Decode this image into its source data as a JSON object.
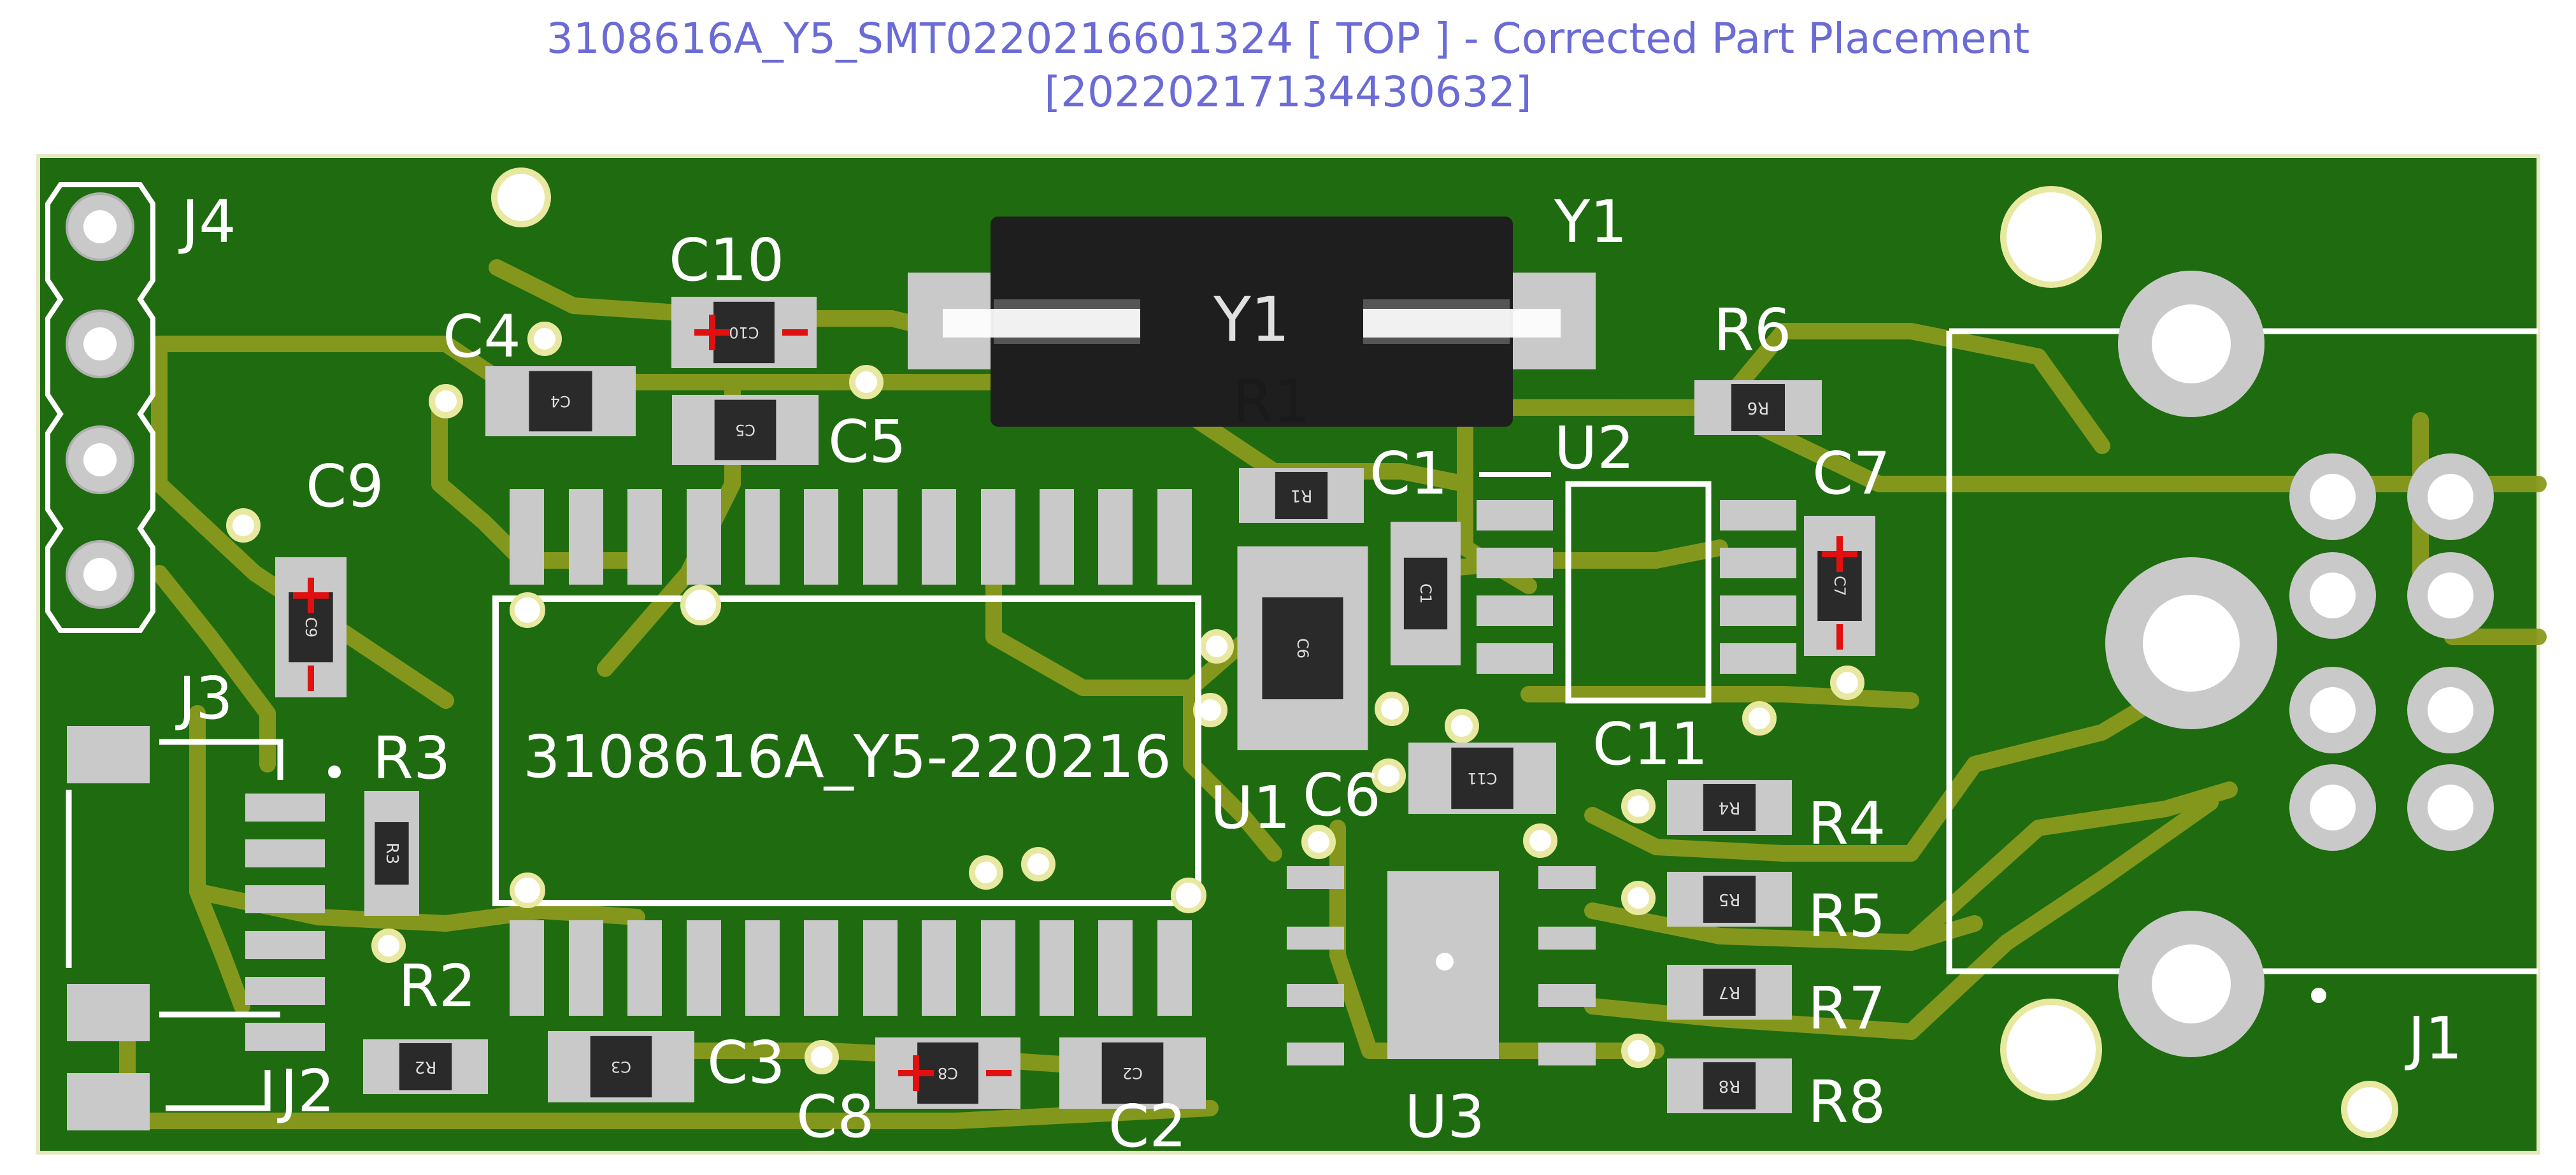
{
  "header": {
    "title": "3108616A_Y5_SMT0220216601324 [ TOP ] - Corrected Part Placement",
    "subtitle": "[20220217134430632]"
  },
  "colors": {
    "board": "#1f6b10",
    "copper": "#8a9a1e",
    "pad": "#c9c9c9",
    "silk": "#ffffff",
    "body": "#2a2a2a",
    "marker": "#e01010",
    "hole": "#ffffff",
    "header_text": "#6b6bd6"
  },
  "board": {
    "ic_label": "3108616A_Y5-220216",
    "crystal_body_label": "Y1"
  },
  "refs": {
    "J1": "J1",
    "J2": "J2",
    "J3": "J3",
    "J4": "J4",
    "Y1": "Y1",
    "R1": "R1",
    "U1": "U1",
    "U2": "U2",
    "U3": "U3",
    "C1": "C1",
    "C2": "C2",
    "C3": "C3",
    "C4": "C4",
    "C5": "C5",
    "C6": "C6",
    "C7": "C7",
    "C8": "C8",
    "C9": "C9",
    "C10": "C10",
    "C11": "C11",
    "R2": "R2",
    "R3": "R3",
    "R4": "R4",
    "R5": "R5",
    "R6": "R6",
    "R7": "R7",
    "R8": "R8"
  },
  "body_labels": {
    "C1": "C1",
    "C2": "C2",
    "C3": "C3",
    "C4": "C4",
    "C5": "C5",
    "C6": "C6",
    "C7": "C7",
    "C8": "C8",
    "C9": "C9",
    "C10": "C10",
    "C11": "C11",
    "R1": "R1",
    "R2": "R2",
    "R3": "R3",
    "R4": "R4",
    "R5": "R5",
    "R6": "R6",
    "R7": "R7",
    "R8": "R8"
  }
}
